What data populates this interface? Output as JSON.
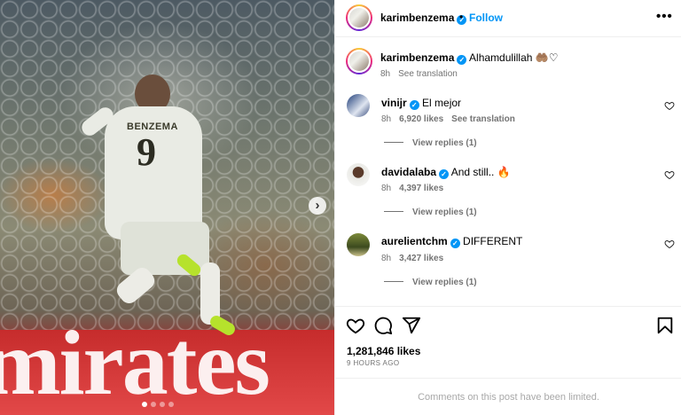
{
  "photo": {
    "jersey_name": "BENZEMA",
    "jersey_number": "9",
    "banner_text": "mirates",
    "slide_count": 4,
    "active_slide": 1
  },
  "header": {
    "username": "karimbenzema",
    "separator": "•",
    "follow_label": "Follow",
    "more_label": "•••"
  },
  "caption": {
    "username": "karimbenzema",
    "text": "Alhamdulillah 🤲🏽♡",
    "time": "8h",
    "see_translation": "See translation"
  },
  "comments": [
    {
      "username": "vinijr",
      "verified": true,
      "text": "El mejor",
      "time": "8h",
      "likes": "6,920 likes",
      "translate": "See translation",
      "replies": "View replies (1)"
    },
    {
      "username": "davidalaba",
      "verified": true,
      "text": "And still.. 🔥",
      "time": "8h",
      "likes": "4,397 likes",
      "translate": "",
      "replies": "View replies (1)"
    },
    {
      "username": "aurelientchm",
      "verified": true,
      "text": "DIFFERENT",
      "time": "8h",
      "likes": "3,427 likes",
      "translate": "",
      "replies": "View replies (1)"
    }
  ],
  "footer": {
    "likes": "1,281,846 likes",
    "time_ago": "9 HOURS AGO",
    "limited_notice": "Comments on this post have been limited."
  },
  "colors": {
    "accent": "#0095f6",
    "muted": "#737373"
  }
}
